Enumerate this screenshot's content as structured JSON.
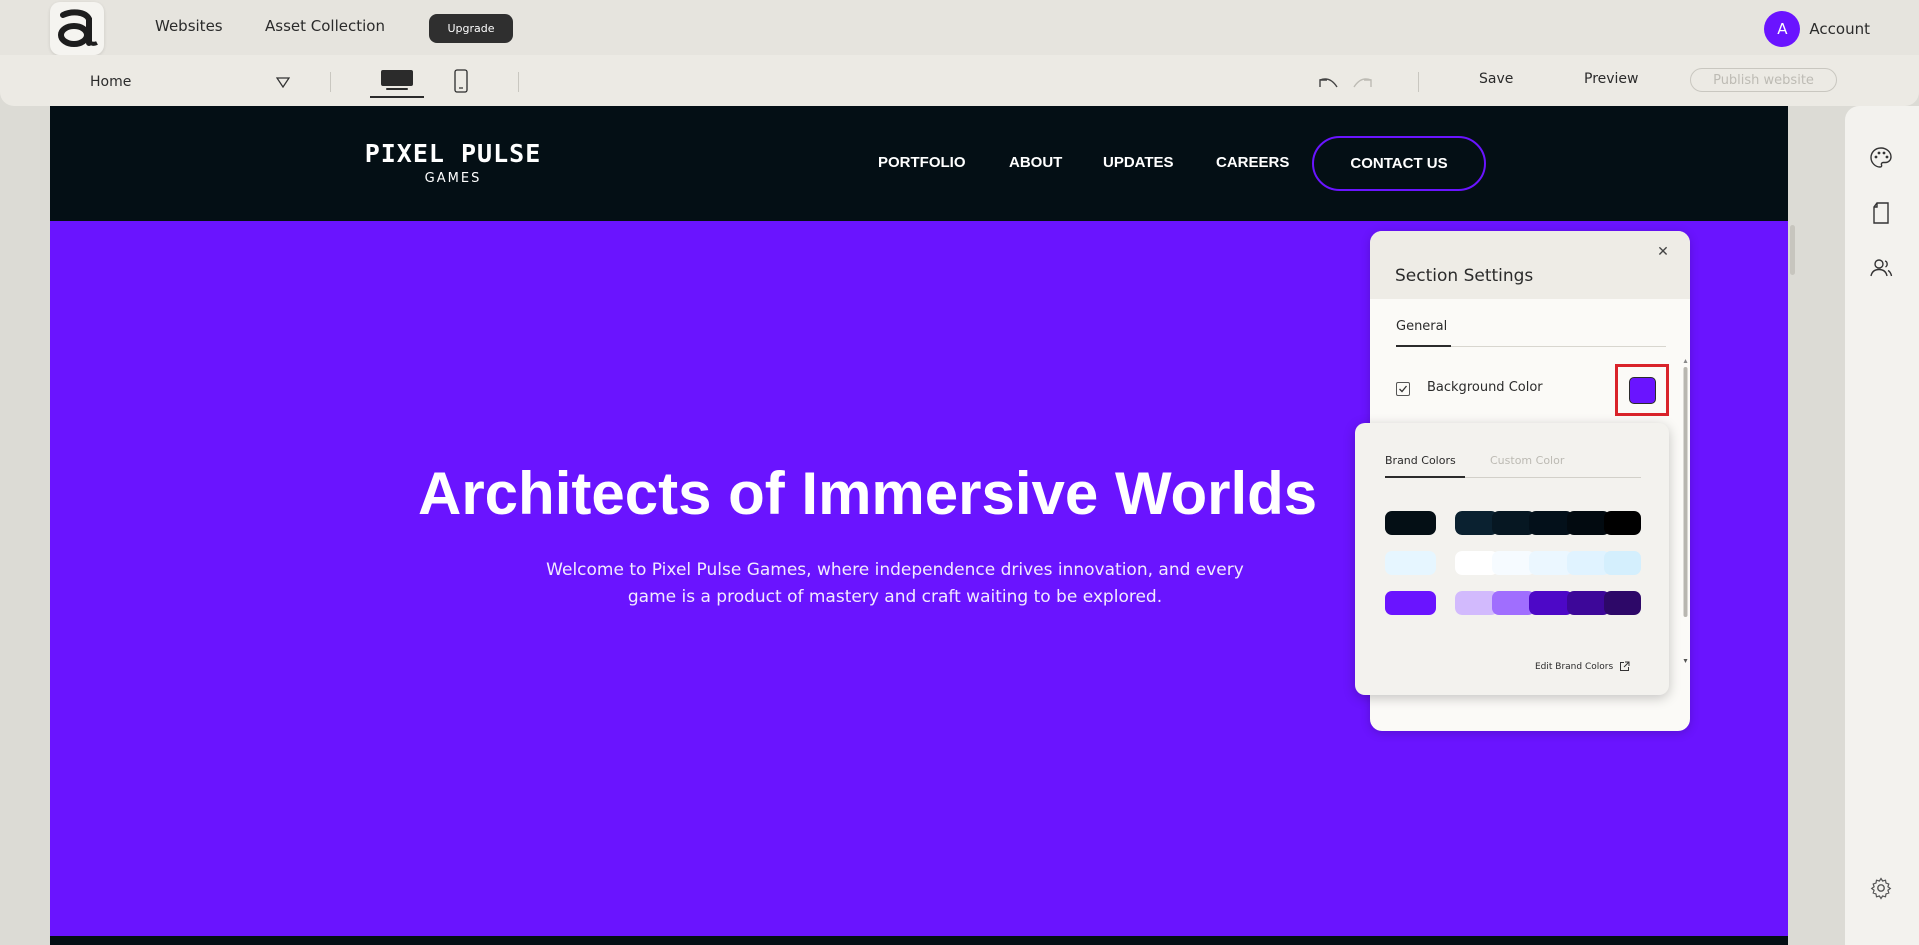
{
  "topbar": {
    "nav": [
      "Websites",
      "Asset Collection"
    ],
    "upgrade_label": "Upgrade",
    "account": {
      "initial": "A",
      "label": "Account"
    }
  },
  "toolbar": {
    "page_name": "Home",
    "save_label": "Save",
    "preview_label": "Preview",
    "publish_label": "Publish website"
  },
  "site": {
    "logo_line1": "PIXEL PULSE",
    "logo_line2": "GAMES",
    "nav": [
      "PORTFOLIO",
      "ABOUT",
      "UPDATES",
      "CAREERS"
    ],
    "contact_label": "CONTACT US",
    "hero_title": "Architects of Immersive Worlds",
    "hero_subtitle": "Welcome to Pixel Pulse Games, where independence drives innovation, and every game is a product of mastery and craft waiting to be explored."
  },
  "section_settings": {
    "title": "Section Settings",
    "tab": "General",
    "background_color_label": "Background Color",
    "background_color_checked": true,
    "background_color_value": "#6a14ff"
  },
  "color_picker": {
    "tabs": [
      "Brand Colors",
      "Custom Color"
    ],
    "active_tab": "Brand Colors",
    "rows": [
      {
        "base": "#040f15",
        "ramp": [
          "#0a2130",
          "#061722",
          "#03101a",
          "#020a10",
          "#000000"
        ]
      },
      {
        "base": "#e6f6ff",
        "ramp": [
          "#ffffff",
          "#f6fbff",
          "#ebf7ff",
          "#e0f3ff",
          "#d4effd"
        ]
      },
      {
        "base": "#6a14ff",
        "ramp": [
          "#d2bafd",
          "#a06efe",
          "#4d08c7",
          "#3d0799",
          "#2d0868"
        ]
      }
    ],
    "edit_label": "Edit Brand Colors"
  },
  "colors": {
    "accent": "#6a14ff",
    "dark": "#040f15",
    "highlight": "#d9232a"
  }
}
